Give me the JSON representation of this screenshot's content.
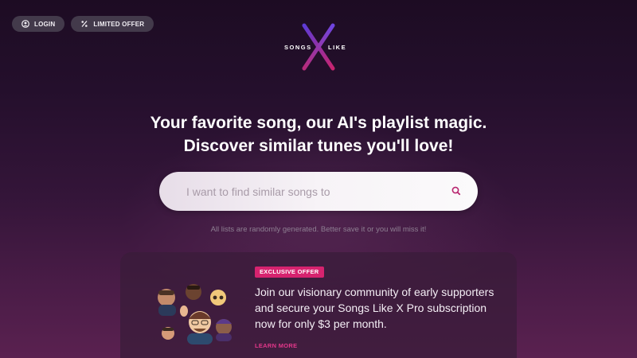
{
  "header": {
    "login_label": "LOGIN",
    "offer_label": "LIMITED OFFER",
    "login_icon": "user-circle-icon",
    "offer_icon": "percent-icon"
  },
  "logo": {
    "left_word": "SONGS",
    "right_word": "LIKE",
    "mark": "X",
    "colors": {
      "stroke_a": "#7a3fd6",
      "stroke_b": "#d6236f"
    }
  },
  "hero": {
    "line1": "Your favorite song, our AI's playlist magic.",
    "line2": "Discover similar tunes you'll love!"
  },
  "search": {
    "placeholder": "I want to find similar songs to",
    "value": "",
    "icon": "search-icon"
  },
  "note": "All lists are randomly generated. Better save it or you will miss it!",
  "offer": {
    "badge": "EXCLUSIVE OFFER",
    "text": "Join our visionary community of early supporters and secure your Songs Like X Pro subscription now for only $3 per month.",
    "link": "LEARN MORE",
    "badge_color": "#d6236f",
    "link_color": "#e3378a"
  },
  "colors": {
    "background_top": "#1d0c23",
    "background_bottom": "#5a2150",
    "pill_bg": "#433a4b"
  }
}
